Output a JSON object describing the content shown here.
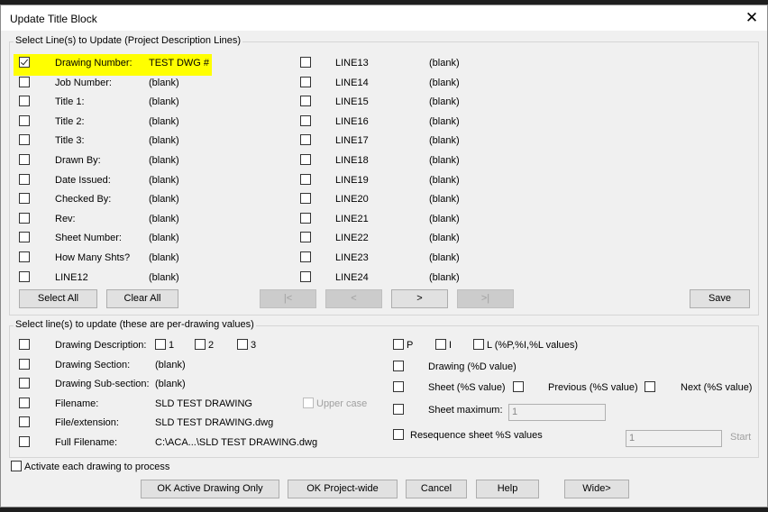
{
  "window": {
    "title": "Update Title Block",
    "close_glyph": "✕"
  },
  "group1": {
    "legend": "Select Line(s) to Update (Project Description Lines)",
    "left_rows": [
      {
        "label": "Drawing Number:",
        "value": "TEST DWG #",
        "checked": true
      },
      {
        "label": "Job Number:",
        "value": "(blank)",
        "checked": false
      },
      {
        "label": "Title 1:",
        "value": "(blank)",
        "checked": false
      },
      {
        "label": "Title 2:",
        "value": "(blank)",
        "checked": false
      },
      {
        "label": "Title 3:",
        "value": "(blank)",
        "checked": false
      },
      {
        "label": "Drawn By:",
        "value": "(blank)",
        "checked": false
      },
      {
        "label": "Date Issued:",
        "value": "(blank)",
        "checked": false
      },
      {
        "label": "Checked By:",
        "value": "(blank)",
        "checked": false
      },
      {
        "label": "Rev:",
        "value": "(blank)",
        "checked": false
      },
      {
        "label": "Sheet Number:",
        "value": "(blank)",
        "checked": false
      },
      {
        "label": "How Many Shts?",
        "value": "(blank)",
        "checked": false
      },
      {
        "label": "LINE12",
        "value": "(blank)",
        "checked": false
      }
    ],
    "right_rows": [
      {
        "label": "LINE13",
        "value": "(blank)",
        "checked": false
      },
      {
        "label": "LINE14",
        "value": "(blank)",
        "checked": false
      },
      {
        "label": "LINE15",
        "value": "(blank)",
        "checked": false
      },
      {
        "label": "LINE16",
        "value": "(blank)",
        "checked": false
      },
      {
        "label": "LINE17",
        "value": "(blank)",
        "checked": false
      },
      {
        "label": "LINE18",
        "value": "(blank)",
        "checked": false
      },
      {
        "label": "LINE19",
        "value": "(blank)",
        "checked": false
      },
      {
        "label": "LINE20",
        "value": "(blank)",
        "checked": false
      },
      {
        "label": "LINE21",
        "value": "(blank)",
        "checked": false
      },
      {
        "label": "LINE22",
        "value": "(blank)",
        "checked": false
      },
      {
        "label": "LINE23",
        "value": "(blank)",
        "checked": false
      },
      {
        "label": "LINE24",
        "value": "(blank)",
        "checked": false
      }
    ],
    "buttons": {
      "select_all": "Select All",
      "clear_all": "Clear All",
      "first": "|<",
      "prev": "<",
      "next": ">",
      "last": ">|",
      "save": "Save"
    }
  },
  "group2": {
    "legend": "Select line(s) to update (these are per-drawing values)",
    "drawing_description": {
      "label": "Drawing Description:",
      "opt1": "1",
      "opt2": "2",
      "opt3": "3"
    },
    "drawing_section": {
      "label": "Drawing Section:",
      "value": "(blank)"
    },
    "drawing_subsection": {
      "label": "Drawing Sub-section:",
      "value": "(blank)"
    },
    "filename": {
      "label": "Filename:",
      "value": "SLD TEST DRAWING",
      "uppercase": "Upper case"
    },
    "file_extension": {
      "label": "File/extension:",
      "value": "SLD TEST DRAWING.dwg"
    },
    "full_filename": {
      "label": "Full Filename:",
      "value": "C:\\ACA...\\SLD TEST DRAWING.dwg"
    },
    "p_label": "P",
    "i_label": "I",
    "l_label": "L (%P,%I,%L values)",
    "drawing_d": "Drawing (%D value)",
    "sheet_s": "Sheet (%S value)",
    "previous_s": "Previous (%S value)",
    "next_s": "Next (%S value)",
    "sheet_max": {
      "label": "Sheet maximum:",
      "value": "1"
    },
    "resequence": {
      "label": "Resequence sheet %S values",
      "value": "1",
      "start": "Start"
    }
  },
  "activate_each": "Activate each drawing to process",
  "footer": {
    "ok_active": "OK Active Drawing Only",
    "ok_project": "OK Project-wide",
    "cancel": "Cancel",
    "help": "Help",
    "wide": "Wide>"
  },
  "colors": {
    "highlight": "#ffff00",
    "dialog_bg": "#f0f0f0"
  }
}
